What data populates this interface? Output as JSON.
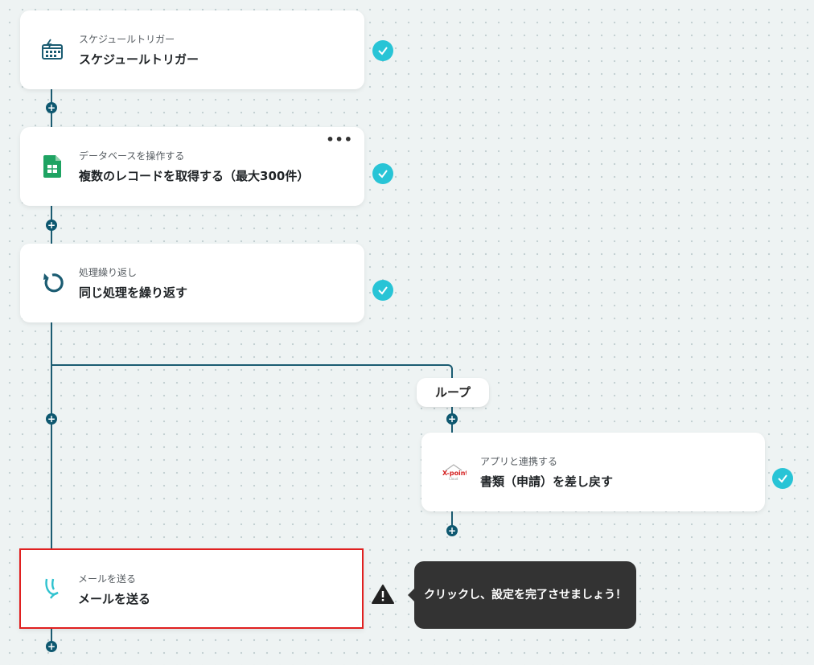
{
  "nodes": {
    "schedule": {
      "subtitle": "スケジュールトリガー",
      "title": "スケジュールトリガー",
      "icon": "calendar-lightning-icon"
    },
    "database": {
      "subtitle": "データベースを操作する",
      "title": "複数のレコードを取得する（最大300件）",
      "icon": "google-sheets-icon",
      "more": "•••"
    },
    "loop": {
      "subtitle": "処理繰り返し",
      "title": "同じ処理を繰り返す",
      "icon": "loop-arrow-icon"
    },
    "app": {
      "subtitle": "アプリと連携する",
      "title": "書類（申請）を差し戻す",
      "icon": "x-point-logo"
    },
    "mail": {
      "subtitle": "メールを送る",
      "title": "メールを送る",
      "icon": "mail-y-icon"
    }
  },
  "loop_label": "ループ",
  "tooltip": "クリックし、設定を完了させましょう！",
  "plus_glyph": "+",
  "colors": {
    "connector": "#1b5c72",
    "check": "#28c4d6",
    "selected_border": "#e02020",
    "sheets": "#1ea362",
    "tooltip_bg": "#333333"
  }
}
